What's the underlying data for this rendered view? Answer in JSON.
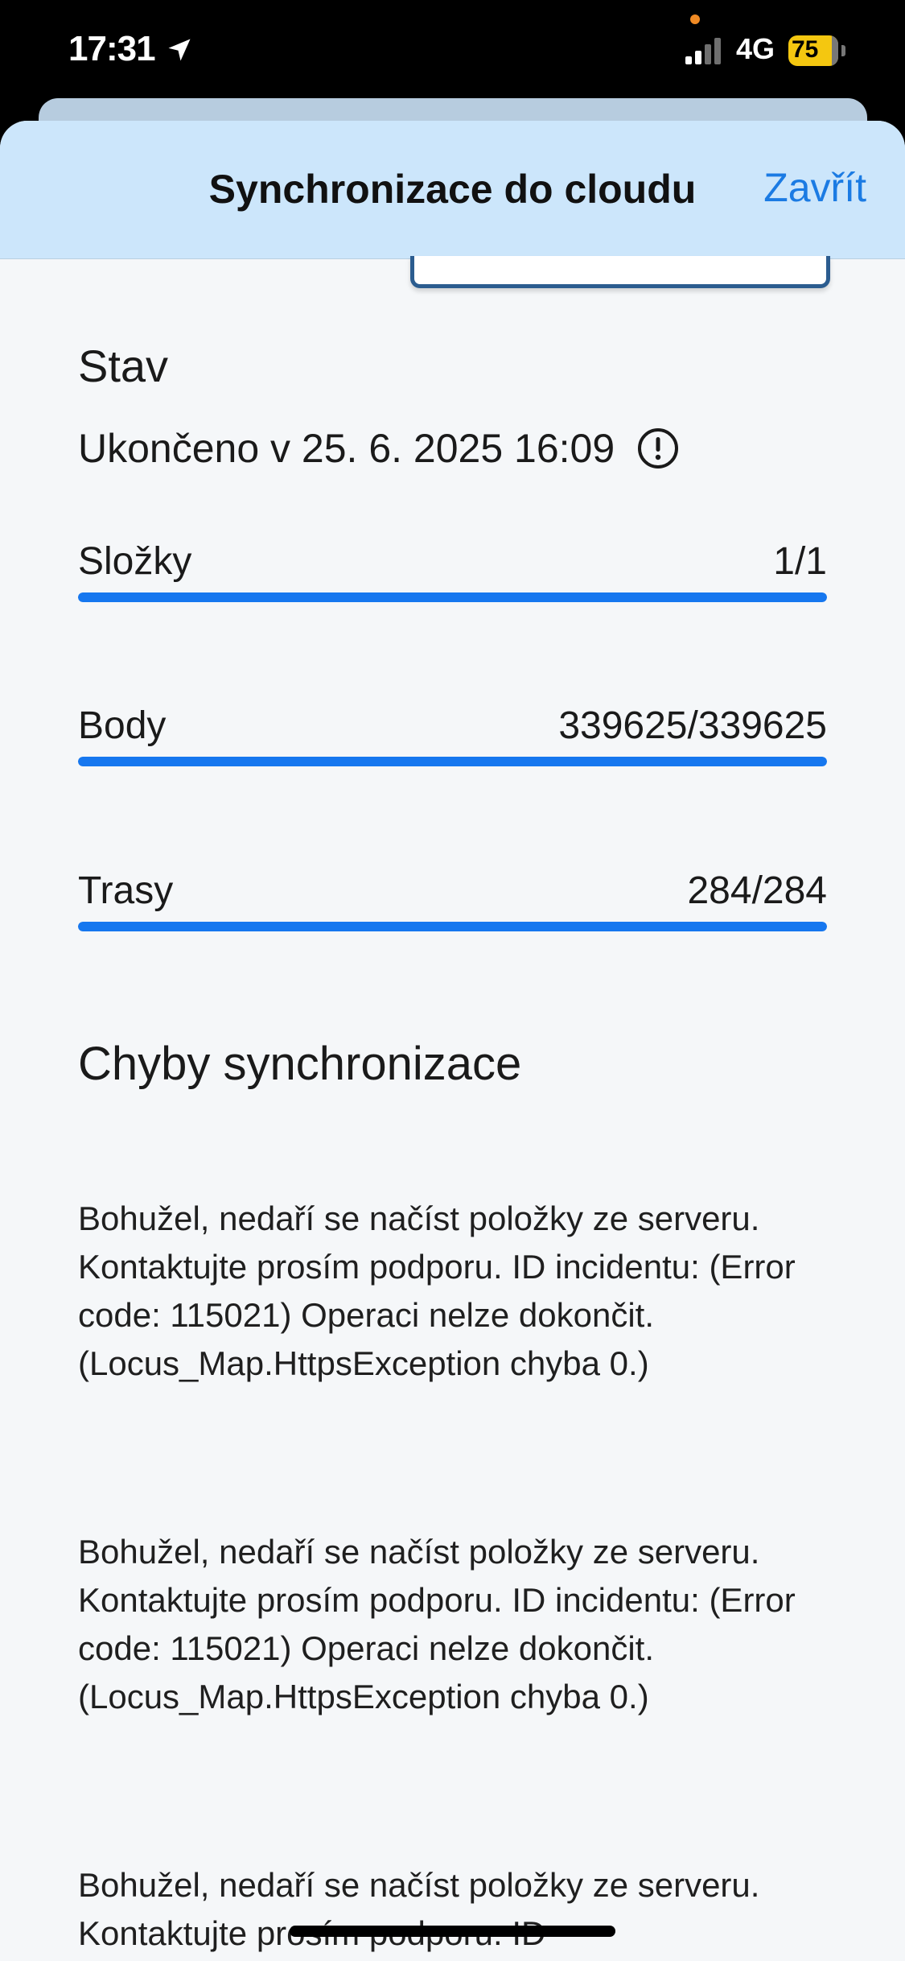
{
  "status_bar": {
    "time": "17:31",
    "network": "4G",
    "battery_level": "75",
    "location_icon": "location-arrow-icon",
    "signal_icon": "cellular-signal-icon"
  },
  "sheet": {
    "title": "Synchronizace do cloudu",
    "close_label": "Zavřít"
  },
  "status": {
    "heading": "Stav",
    "finished_text": "Ukončeno v 25. 6. 2025 16:09",
    "info_icon": "info-circle-icon"
  },
  "progress_rows": [
    {
      "label": "Složky",
      "value": "1/1",
      "fraction": 1.0
    },
    {
      "label": "Body",
      "value": "339625/339625",
      "fraction": 1.0
    },
    {
      "label": "Trasy",
      "value": "284/284",
      "fraction": 1.0
    }
  ],
  "errors": {
    "heading": "Chyby synchronizace",
    "items": [
      "Bohužel, nedaří se načíst položky ze serveru. Kontaktujte prosím podporu. ID incidentu:  (Error code: 115021) Operaci nelze dokončit. (Locus_Map.HttpsException chyba 0.)",
      "Bohužel, nedaří se načíst položky ze serveru. Kontaktujte prosím podporu. ID incidentu:  (Error code: 115021) Operaci nelze dokončit. (Locus_Map.HttpsException chyba 0.)",
      "Bohužel, nedaří se načíst položky ze serveru. Kontaktujte prosím podporu. ID"
    ]
  },
  "colors": {
    "accent": "#1677ef",
    "header_bg": "#cce6fb",
    "battery": "#f4c710",
    "close_link": "#1b7be3"
  }
}
